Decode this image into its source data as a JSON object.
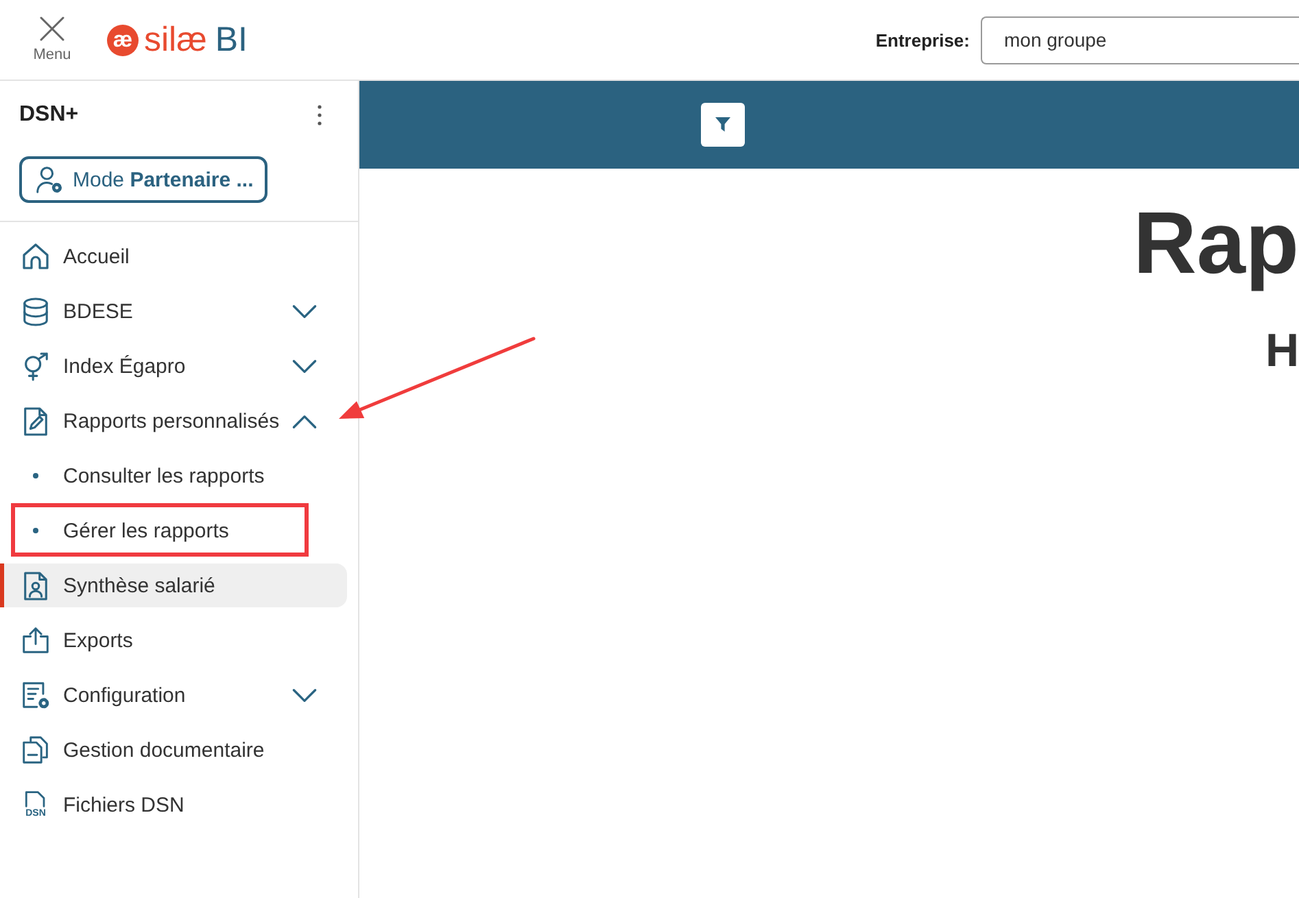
{
  "header": {
    "menu_label": "Menu",
    "logo": {
      "mark": "æ",
      "name": "silæ",
      "suffix": "BI"
    },
    "company": {
      "label": "Entreprise:",
      "value": "mon groupe"
    }
  },
  "sidebar": {
    "title": "DSN+",
    "mode_button": "Mode **Partenaire ...**",
    "items": [
      {
        "kind": "link",
        "label": "Accueil",
        "selected": false
      },
      {
        "kind": "group",
        "label": "BDESE",
        "selected": false,
        "expanded": false
      },
      {
        "kind": "group",
        "label": "Index Égapro",
        "selected": false,
        "expanded": false
      },
      {
        "kind": "group",
        "label": "Rapports personnalisés",
        "selected": false,
        "expanded": true,
        "children": [
          {
            "label": "Consulter les rapports",
            "selected": false,
            "outlined": false
          },
          {
            "label": "Gérer les rapports",
            "selected": false,
            "outlined": true
          }
        ]
      },
      {
        "kind": "link",
        "label": "Synthèse salarié",
        "selected": true
      },
      {
        "kind": "link",
        "label": "Exports",
        "selected": false
      },
      {
        "kind": "group",
        "label": "Configuration",
        "selected": false,
        "expanded": false
      },
      {
        "kind": "link",
        "label": "Gestion documentaire",
        "selected": false
      },
      {
        "kind": "link",
        "label": "Fichiers DSN",
        "selected": false,
        "icon_label": "DSN"
      }
    ]
  },
  "main": {
    "heading": "Rap",
    "subheading": "H"
  },
  "annotations": [
    {
      "kind": "arrow"
    }
  ]
}
